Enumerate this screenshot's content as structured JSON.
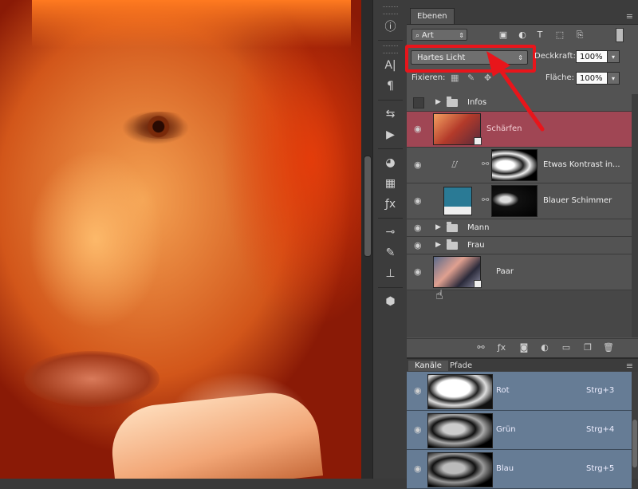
{
  "layers_panel": {
    "tab_label": "Ebenen",
    "filter_label": "Art",
    "blend_mode": "Hartes Licht",
    "opacity_label": "Deckkraft:",
    "opacity_value": "100%",
    "lock_label": "Fixieren:",
    "fill_label": "Fläche:",
    "fill_value": "100%",
    "layers": [
      {
        "name": "Infos"
      },
      {
        "name": "Schärfen"
      },
      {
        "name": "Etwas Kontrast in..."
      },
      {
        "name": "Blauer Schimmer"
      },
      {
        "name": "Mann"
      },
      {
        "name": "Frau"
      },
      {
        "name": "Paar"
      }
    ]
  },
  "channels_panel": {
    "tabs": [
      "Kanäle",
      "Pfade"
    ],
    "channels": [
      {
        "name": "Rot",
        "shortcut": "Strg+3"
      },
      {
        "name": "Grün",
        "shortcut": "Strg+4"
      },
      {
        "name": "Blau",
        "shortcut": "Strg+5"
      }
    ]
  },
  "annotation": {
    "color": "#e8151b"
  },
  "colors": {
    "selected_layer": "#a04654",
    "channel_row": "#667c95",
    "panel_bg": "#535353"
  }
}
